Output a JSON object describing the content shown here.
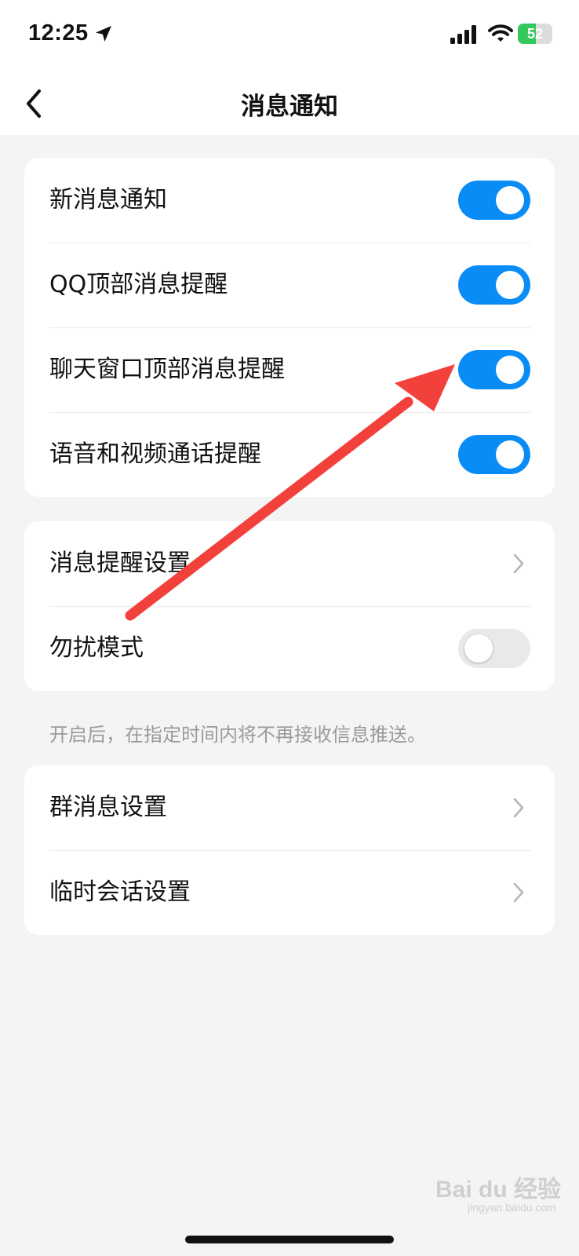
{
  "status_bar": {
    "time": "12:25",
    "battery_level": "52",
    "battery_fraction": 0.52,
    "icons": [
      "location-icon",
      "signal-icon",
      "wifi-icon",
      "battery-icon"
    ]
  },
  "nav": {
    "title": "消息通知",
    "back_icon": "back-chevron-icon"
  },
  "section1": {
    "items": [
      {
        "label": "新消息通知",
        "toggle_on": true
      },
      {
        "label": "QQ顶部消息提醒",
        "toggle_on": true
      },
      {
        "label": "聊天窗口顶部消息提醒",
        "toggle_on": true
      },
      {
        "label": "语音和视频通话提醒",
        "toggle_on": true
      }
    ]
  },
  "section2": {
    "items": [
      {
        "label": "消息提醒设置",
        "control": "chevron-right-icon"
      },
      {
        "label": "勿扰模式",
        "toggle_on": false
      }
    ],
    "hint": "开启后，在指定时间内将不再接收信息推送。"
  },
  "section3": {
    "items": [
      {
        "label": "群消息设置",
        "control": "chevron-right-icon"
      },
      {
        "label": "临时会话设置",
        "control": "chevron-right-icon"
      }
    ]
  },
  "watermark": {
    "text": "Bai du 经验",
    "sub": "jingyan.baidu.com"
  },
  "colors": {
    "toggle_on": "#0a8cf6",
    "toggle_off": "#e9e9ea",
    "annotation_arrow": "#f2413b",
    "background": "#f4f4f4"
  }
}
